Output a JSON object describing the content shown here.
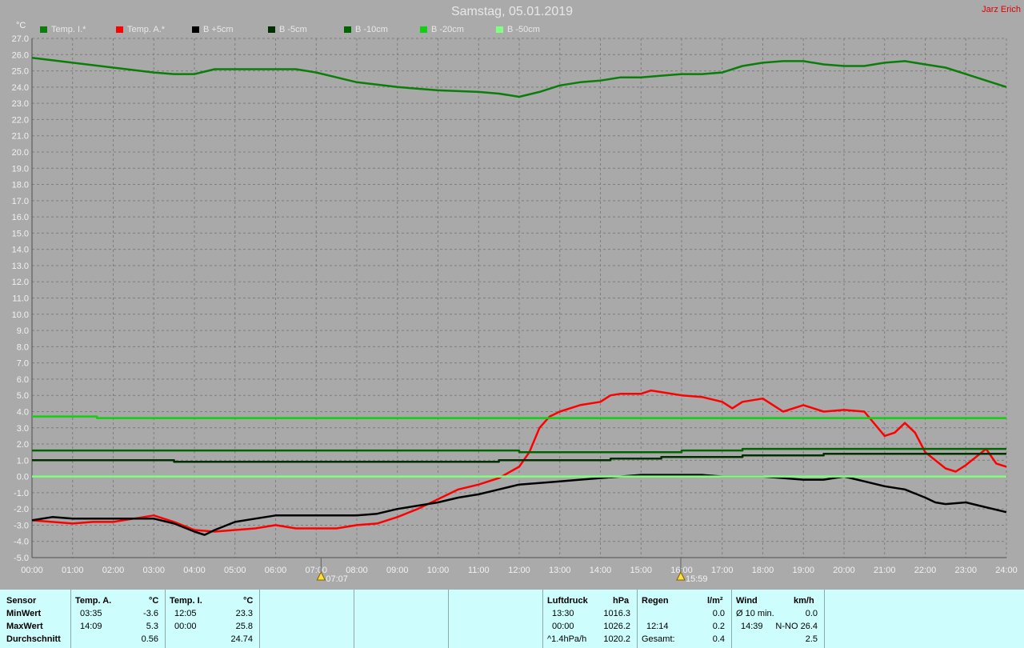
{
  "header": {
    "title": "Samstag, 05.01.2019",
    "author": "Jarz Erich",
    "unit": "°C"
  },
  "legend": [
    {
      "label": "Temp. I.*",
      "color": "#0a7d0a"
    },
    {
      "label": "Temp. A.*",
      "color": "#ff0000"
    },
    {
      "label": "B +5cm",
      "color": "#000000"
    },
    {
      "label": "B -5cm",
      "color": "#003000"
    },
    {
      "label": "B -10cm",
      "color": "#006400"
    },
    {
      "label": "B -20cm",
      "color": "#10d010"
    },
    {
      "label": "B -50cm",
      "color": "#80ff80"
    }
  ],
  "chart_data": {
    "type": "line",
    "xlabel": "",
    "ylabel": "°C",
    "xlim": [
      0,
      24
    ],
    "ylim": [
      -5,
      27
    ],
    "x_ticks": [
      "00:00",
      "01:00",
      "02:00",
      "03:00",
      "04:00",
      "05:00",
      "06:00",
      "07:00",
      "08:00",
      "09:00",
      "10:00",
      "11:00",
      "12:00",
      "13:00",
      "14:00",
      "15:00",
      "16:00",
      "17:00",
      "18:00",
      "19:00",
      "20:00",
      "21:00",
      "22:00",
      "23:00",
      "24:00"
    ],
    "y_ticks": [
      "27.0",
      "26.0",
      "25.0",
      "24.0",
      "23.0",
      "22.0",
      "21.0",
      "20.0",
      "19.0",
      "18.0",
      "17.0",
      "16.0",
      "15.0",
      "14.0",
      "13.0",
      "12.0",
      "11.0",
      "10.0",
      "9.0",
      "8.0",
      "7.0",
      "6.0",
      "5.0",
      "4.0",
      "3.0",
      "2.0",
      "1.0",
      "0.0",
      "-1.0",
      "-2.0",
      "-3.0",
      "-4.0",
      "-5.0"
    ],
    "grid": true,
    "markers": [
      {
        "label": "07:07",
        "hour": 7.12,
        "icon": "sunrise-icon"
      },
      {
        "label": "15:59",
        "hour": 15.98,
        "icon": "sunset-icon"
      }
    ],
    "series": [
      {
        "name": "Temp. I.*",
        "color": "#0a7d0a",
        "x": [
          0,
          1,
          2,
          3,
          3.5,
          4,
          4.5,
          5,
          5.5,
          6,
          6.5,
          7,
          7.5,
          8,
          9,
          10,
          11,
          11.5,
          12,
          12.5,
          13,
          13.5,
          14,
          14.5,
          15,
          15.5,
          16,
          16.5,
          17,
          17.5,
          18,
          18.5,
          19,
          19.5,
          20,
          20.5,
          21,
          21.5,
          22,
          22.5,
          23,
          23.5,
          24
        ],
        "y": [
          25.8,
          25.5,
          25.2,
          24.9,
          24.8,
          24.8,
          25.1,
          25.1,
          25.1,
          25.1,
          25.1,
          24.9,
          24.6,
          24.3,
          24.0,
          23.8,
          23.7,
          23.6,
          23.4,
          23.7,
          24.1,
          24.3,
          24.4,
          24.6,
          24.6,
          24.7,
          24.8,
          24.8,
          24.9,
          25.3,
          25.5,
          25.6,
          25.6,
          25.4,
          25.3,
          25.3,
          25.5,
          25.6,
          25.4,
          25.2,
          24.8,
          24.4,
          24.0
        ]
      },
      {
        "name": "Temp. A.*",
        "color": "#ff0000",
        "x": [
          0,
          0.5,
          1,
          1.5,
          2,
          2.5,
          3,
          3.5,
          4,
          4.5,
          5,
          5.5,
          6,
          6.5,
          7,
          7.5,
          8,
          8.5,
          9,
          9.5,
          10,
          10.5,
          11,
          11.5,
          12,
          12.25,
          12.5,
          12.75,
          13,
          13.5,
          14,
          14.25,
          14.5,
          15,
          15.25,
          15.5,
          16,
          16.5,
          17,
          17.25,
          17.5,
          18,
          18.5,
          19,
          19.5,
          20,
          20.5,
          21,
          21.25,
          21.5,
          21.75,
          22,
          22.5,
          22.75,
          23,
          23.25,
          23.5,
          23.75,
          24
        ],
        "y": [
          -2.7,
          -2.8,
          -2.9,
          -2.8,
          -2.8,
          -2.6,
          -2.4,
          -2.8,
          -3.3,
          -3.4,
          -3.3,
          -3.2,
          -3.0,
          -3.2,
          -3.2,
          -3.2,
          -3.0,
          -2.9,
          -2.5,
          -2.0,
          -1.4,
          -0.8,
          -0.5,
          -0.1,
          0.6,
          1.5,
          3.0,
          3.7,
          4.0,
          4.4,
          4.6,
          5.0,
          5.1,
          5.1,
          5.3,
          5.2,
          5.0,
          4.9,
          4.6,
          4.2,
          4.6,
          4.8,
          4.0,
          4.4,
          4.0,
          4.1,
          4.0,
          2.5,
          2.7,
          3.3,
          2.7,
          1.5,
          0.5,
          0.3,
          0.7,
          1.2,
          1.7,
          0.8,
          0.6
        ]
      },
      {
        "name": "B +5cm",
        "color": "#000000",
        "x": [
          0,
          0.5,
          1,
          1.5,
          2,
          2.5,
          3,
          3.5,
          4,
          4.25,
          4.5,
          5,
          5.5,
          6,
          6.5,
          7,
          7.5,
          8,
          8.5,
          9,
          9.5,
          10,
          10.5,
          11,
          11.5,
          12,
          12.5,
          13,
          13.5,
          14,
          14.5,
          15,
          15.5,
          16,
          16.5,
          17,
          17.5,
          18,
          18.5,
          19,
          19.5,
          20,
          20.5,
          21,
          21.5,
          22,
          22.25,
          22.5,
          23,
          23.5,
          24
        ],
        "y": [
          -2.7,
          -2.5,
          -2.6,
          -2.6,
          -2.6,
          -2.6,
          -2.6,
          -2.9,
          -3.4,
          -3.6,
          -3.3,
          -2.8,
          -2.6,
          -2.4,
          -2.4,
          -2.4,
          -2.4,
          -2.4,
          -2.3,
          -2.0,
          -1.8,
          -1.6,
          -1.3,
          -1.1,
          -0.8,
          -0.5,
          -0.4,
          -0.3,
          -0.2,
          -0.1,
          0.0,
          0.1,
          0.1,
          0.1,
          0.1,
          0.0,
          0.0,
          0.0,
          -0.1,
          -0.2,
          -0.2,
          0.0,
          -0.3,
          -0.6,
          -0.8,
          -1.3,
          -1.6,
          -1.7,
          -1.6,
          -1.9,
          -2.2
        ]
      },
      {
        "name": "B -5cm",
        "color": "#003000",
        "x": [
          0,
          3.5,
          3.5,
          11.5,
          11.5,
          14.25,
          14.25,
          15.5,
          15.5,
          17.5,
          17.5,
          19.5,
          19.5,
          24
        ],
        "y": [
          1.0,
          1.0,
          0.9,
          0.9,
          1.0,
          1.0,
          1.1,
          1.1,
          1.2,
          1.2,
          1.3,
          1.3,
          1.4,
          1.4
        ]
      },
      {
        "name": "B -10cm",
        "color": "#006400",
        "x": [
          0,
          12,
          12,
          16,
          16,
          17.5,
          17.5,
          24
        ],
        "y": [
          1.6,
          1.6,
          1.5,
          1.5,
          1.6,
          1.6,
          1.7,
          1.7
        ]
      },
      {
        "name": "B -20cm",
        "color": "#10d010",
        "x": [
          0,
          1.6,
          1.6,
          24
        ],
        "y": [
          3.7,
          3.7,
          3.6,
          3.6
        ]
      },
      {
        "name": "B -50cm",
        "color": "#80ff80",
        "x": [
          0,
          24
        ],
        "y": [
          0.0,
          0.0
        ]
      }
    ]
  },
  "stats": {
    "sensor_header": "Sensor",
    "row_labels": [
      "MinWert",
      "MaxWert",
      "Durchschnitt"
    ],
    "temp_a": {
      "header": "Temp. A.",
      "unit": "°C",
      "min_time": "03:35",
      "min_val": "-3.6",
      "max_time": "14:09",
      "max_val": "5.3",
      "avg": "0.56"
    },
    "temp_i": {
      "header": "Temp. I.",
      "unit": "°C",
      "min_time": "12:05",
      "min_val": "23.3",
      "max_time": "00:00",
      "max_val": "25.8",
      "avg": "24.74"
    },
    "pressure": {
      "header": "Luftdruck",
      "unit": "hPa",
      "min_time": "13:30",
      "min_val": "1016.3",
      "max_time": "00:00",
      "max_val": "1026.2",
      "trend": "^1.4hPa/h",
      "avg": "1020.2"
    },
    "rain": {
      "header": "Regen",
      "unit": "l/m²",
      "min_val": "0.0",
      "max_time": "12:14",
      "max_val": "0.2",
      "total_label": "Gesamt:",
      "total": "0.4"
    },
    "wind": {
      "header": "Wind",
      "unit": "km/h",
      "avg_label": "Ø 10 min.",
      "avg_val": "0.0",
      "max_time": "14:39",
      "max_val": "N-NO 26.4",
      "mean": "2.5"
    }
  }
}
